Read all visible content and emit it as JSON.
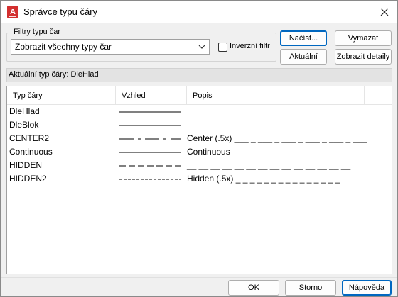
{
  "window": {
    "title": "Správce typu čáry",
    "icon": "autocad-a-icon",
    "accent_color": "#d32f2f",
    "close_icon": "close-icon"
  },
  "filters": {
    "legend": "Filtry typu čar",
    "selected": "Zobrazit všechny typy čar",
    "inverse_label": "Inverzní filtr",
    "inverse_checked": false
  },
  "buttons": {
    "load": "Načíst...",
    "delete": "Vymazat",
    "current": "Aktuální",
    "details": "Zobrazit detaily"
  },
  "status": {
    "label": "Aktuální typ čáry:",
    "value": "DleHlad"
  },
  "table": {
    "columns": [
      "Typ čáry",
      "Vzhled",
      "Popis"
    ],
    "rows": [
      {
        "name": "DleHlad",
        "pattern": "solid",
        "description": ""
      },
      {
        "name": "DleBlok",
        "pattern": "solid",
        "description": ""
      },
      {
        "name": "CENTER2",
        "pattern": "center",
        "description": "Center (.5x) ___ _ ___ _ ___ _ ___ _ ___ _ ___"
      },
      {
        "name": "Continuous",
        "pattern": "solid",
        "description": "Continuous"
      },
      {
        "name": "HIDDEN",
        "pattern": "hidden",
        "description": "__ __ __ __ __ __ __ __ __ __ __ __ __ __"
      },
      {
        "name": "HIDDEN2",
        "pattern": "hidden2",
        "description": "Hidden (.5x) _ _ _ _ _ _ _ _ _ _ _ _ _ _ _"
      }
    ]
  },
  "footer": {
    "ok": "OK",
    "cancel": "Storno",
    "help": "Nápověda"
  }
}
